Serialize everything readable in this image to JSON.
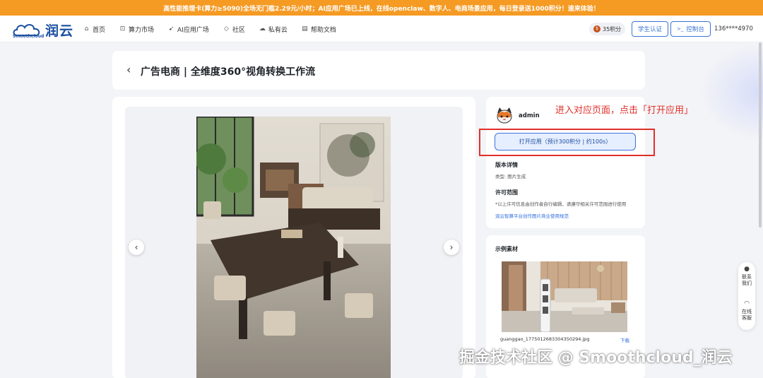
{
  "banner": {
    "text": "高性能推理卡(算力≥5090)全场无门槛2.29元/小时；AI应用广场已上线，在线openclaw、数字人、电商场景应用，每日登录送1000积分！速来体验！"
  },
  "header": {
    "brand_cn": "润云",
    "brand_en": "Smoothcloud",
    "nav": [
      {
        "label": "首页",
        "icon": "home-icon",
        "glyph": "⌂"
      },
      {
        "label": "算力市场",
        "icon": "cart-icon",
        "glyph": "⊡"
      },
      {
        "label": "AI应用广场",
        "icon": "rocket-icon",
        "glyph": "➹"
      },
      {
        "label": "社区",
        "icon": "community-icon",
        "glyph": "◇"
      },
      {
        "label": "私有云",
        "icon": "cloud-icon",
        "glyph": "☁"
      },
      {
        "label": "帮助文档",
        "icon": "doc-icon",
        "glyph": "▤"
      }
    ],
    "points": "35积分",
    "student_auth": "学生认证",
    "console": "控制台",
    "console_icon": ">_",
    "user": "136****4970"
  },
  "page": {
    "back_icon": "‹",
    "title": "广告电商 | 全维度360°视角转换工作流"
  },
  "carousel": {
    "prev": "‹",
    "next": "›"
  },
  "app_info": {
    "author": "admin",
    "open_button": "打开应用（预计300积分 | 约100s）",
    "version_heading": "版本详情",
    "type_text": "类型: 图片生成",
    "license_heading": "许可范围",
    "license_text": "*以上许可信息由创作者自行编辑，请遵守相关许可范围进行使用",
    "license_link": "润云智算平台创作图片商业使用规范"
  },
  "annotation": {
    "text": "进入对应页面，点击「打开应用」"
  },
  "samples": {
    "heading": "示例素材",
    "file_name": "guanggao_1775012683304350294.jpg",
    "download": "下载"
  },
  "float_panel": {
    "contact": [
      "联系",
      "我们"
    ],
    "service": [
      "在线",
      "客服"
    ]
  },
  "watermark": "掘金技术社区 @ Smoothcloud_润云",
  "colors": {
    "banner": "#f59a23",
    "accent": "#3b73d9",
    "annotation": "#e0302a"
  }
}
